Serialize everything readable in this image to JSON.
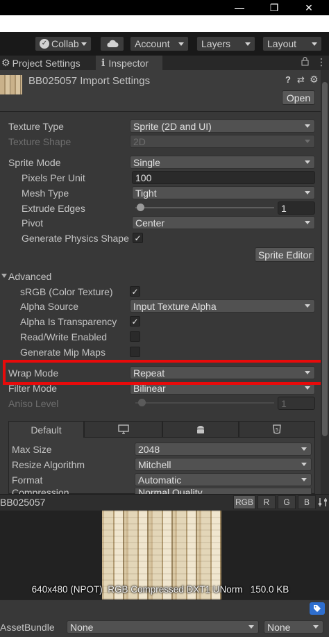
{
  "window": {
    "minimize_glyph": "—",
    "restore_glyph": "❐",
    "close_glyph": "✕"
  },
  "toolbar": {
    "collab_label": "Collab",
    "cloud_icon": "cloud-icon",
    "account_label": "Account",
    "layers_label": "Layers",
    "layout_label": "Layout"
  },
  "tabs": {
    "project_settings": "Project Settings",
    "inspector": "Inspector",
    "gear_glyph": "⚙",
    "info_glyph": "ℹ",
    "lock_glyph": "🔒",
    "menu_glyph": "⋮"
  },
  "header": {
    "title": "BB025057 Import Settings",
    "open_label": "Open",
    "help_glyph": "?",
    "preset_glyph": "⇄",
    "settings_glyph": "⚙"
  },
  "settings": {
    "texture_type_label": "Texture Type",
    "texture_type_value": "Sprite (2D and UI)",
    "texture_shape_label": "Texture Shape",
    "texture_shape_value": "2D",
    "sprite_mode_label": "Sprite Mode",
    "sprite_mode_value": "Single",
    "ppu_label": "Pixels Per Unit",
    "ppu_value": "100",
    "mesh_type_label": "Mesh Type",
    "mesh_type_value": "Tight",
    "extrude_label": "Extrude Edges",
    "extrude_value": "1",
    "pivot_label": "Pivot",
    "pivot_value": "Center",
    "physics_label": "Generate Physics Shape",
    "physics_checked": "✓",
    "sprite_editor_label": "Sprite Editor",
    "advanced_label": "Advanced",
    "srgb_label": "sRGB (Color Texture)",
    "srgb_checked": "✓",
    "alpha_source_label": "Alpha Source",
    "alpha_source_value": "Input Texture Alpha",
    "alpha_transparency_label": "Alpha Is Transparency",
    "alpha_transparency_checked": "✓",
    "read_write_label": "Read/Write Enabled",
    "mipmaps_label": "Generate Mip Maps",
    "wrap_mode_label": "Wrap Mode",
    "wrap_mode_value": "Repeat",
    "filter_mode_label": "Filter Mode",
    "filter_mode_value": "Bilinear",
    "aniso_label": "Aniso Level",
    "aniso_value": "1"
  },
  "platform": {
    "default_tab": "Default",
    "monitor_glyph": "🖵",
    "android_glyph": "🤖",
    "html5_glyph": "5",
    "max_size_label": "Max Size",
    "max_size_value": "2048",
    "resize_label": "Resize Algorithm",
    "resize_value": "Mitchell",
    "format_label": "Format",
    "format_value": "Automatic",
    "compression_label": "Compression",
    "compression_value": "Normal Quality"
  },
  "preview": {
    "name": "BB025057",
    "channels": [
      "RGB",
      "R",
      "G",
      "B"
    ],
    "info": "640x480 (NPOT)  RGB Compressed DXT1 UNorm   150.0 KB"
  },
  "footer": {
    "assetbundle_label": "AssetBundle",
    "bundle_value": "None",
    "variant_value": "None"
  },
  "colors": {
    "accent_red": "#e80a0a",
    "panel_bg": "#383838"
  }
}
